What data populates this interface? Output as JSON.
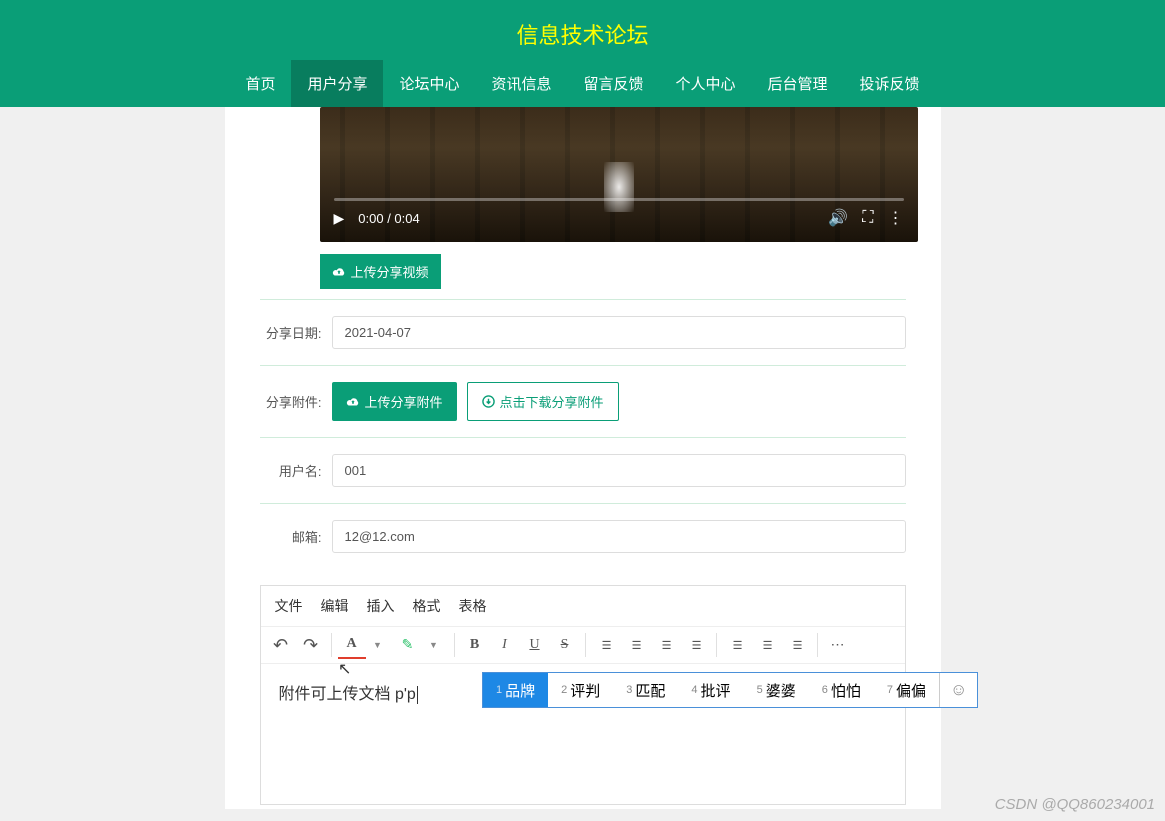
{
  "header": {
    "title": "信息技术论坛",
    "nav": [
      "首页",
      "用户分享",
      "论坛中心",
      "资讯信息",
      "留言反馈",
      "个人中心",
      "后台管理",
      "投诉反馈"
    ],
    "active_index": 1
  },
  "video": {
    "time": "0:00 / 0:04"
  },
  "buttons": {
    "upload_video": "上传分享视频",
    "upload_attach": "上传分享附件",
    "download_attach": "点击下载分享附件"
  },
  "form": {
    "date_label": "分享日期:",
    "date_value": "2021-04-07",
    "attach_label": "分享附件:",
    "username_label": "用户名:",
    "username_value": "001",
    "email_label": "邮箱:",
    "email_value": "12@12.com"
  },
  "editor": {
    "menus": [
      "文件",
      "编辑",
      "插入",
      "格式",
      "表格"
    ],
    "content": "附件可上传文档 p'p"
  },
  "ime": {
    "candidates": [
      {
        "n": "1",
        "t": "品牌"
      },
      {
        "n": "2",
        "t": "评判"
      },
      {
        "n": "3",
        "t": "匹配"
      },
      {
        "n": "4",
        "t": "批评"
      },
      {
        "n": "5",
        "t": "婆婆"
      },
      {
        "n": "6",
        "t": "怕怕"
      },
      {
        "n": "7",
        "t": "偏偏"
      }
    ]
  },
  "watermark": "CSDN @QQ860234001"
}
